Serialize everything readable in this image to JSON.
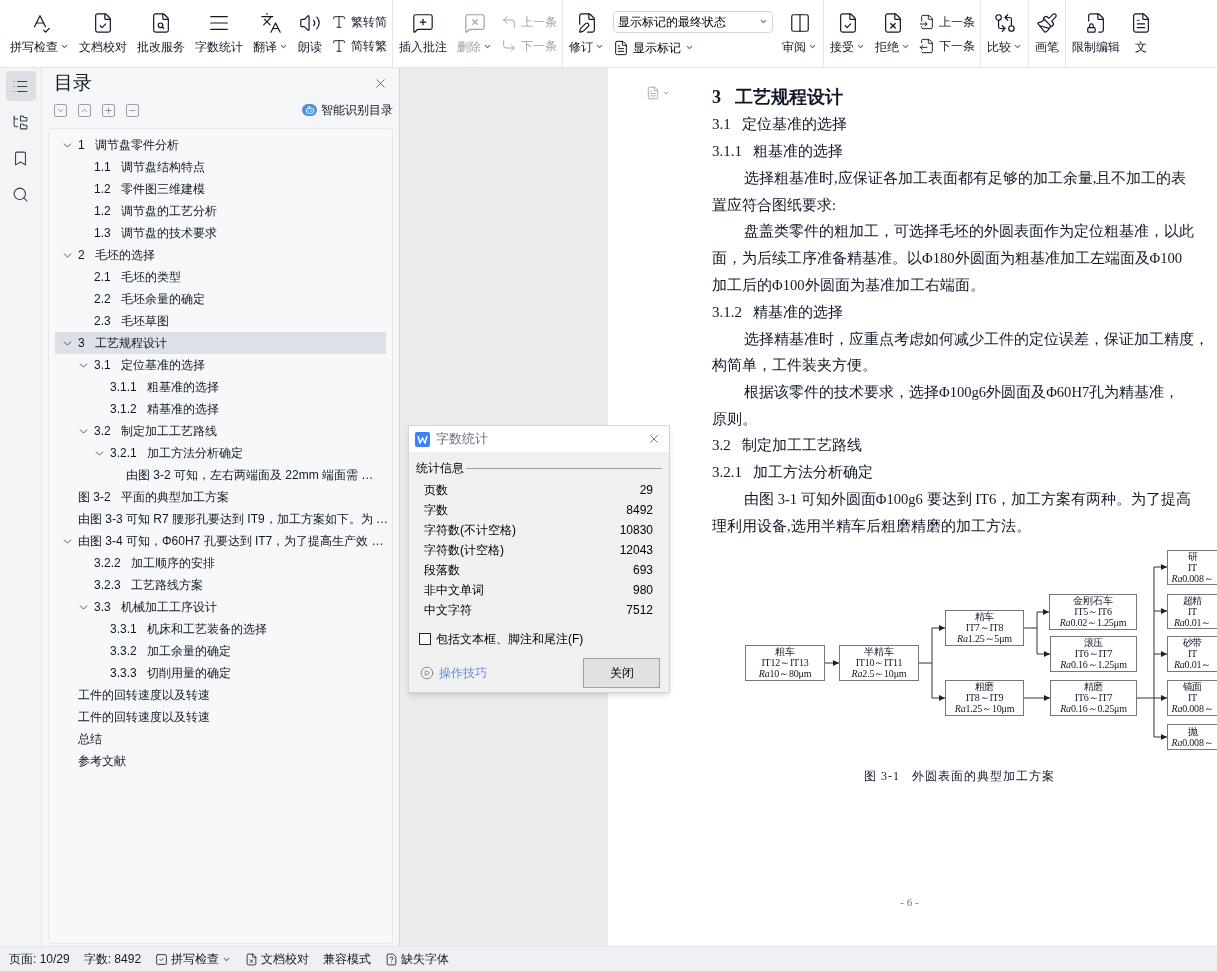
{
  "toolbar": {
    "groups": [
      {
        "items": [
          {
            "kind": "big",
            "label": "拼写检查",
            "menu": true,
            "disabled": false
          },
          {
            "kind": "big",
            "label": "文档校对",
            "menu": false,
            "disabled": false
          },
          {
            "kind": "big",
            "label": "批改服务",
            "menu": false,
            "disabled": false
          },
          {
            "kind": "big",
            "label": "字数统计",
            "menu": false,
            "disabled": false
          },
          {
            "kind": "big",
            "label": "翻译",
            "menu": true,
            "disabled": false
          },
          {
            "kind": "big",
            "label": "朗读",
            "menu": false,
            "disabled": false
          },
          {
            "kind": "pair",
            "buttons": [
              {
                "label": "繁转简",
                "disabled": false
              },
              {
                "label": "简转繁",
                "disabled": false
              }
            ]
          }
        ]
      },
      {
        "items": [
          {
            "kind": "big",
            "label": "插入批注",
            "menu": false,
            "disabled": false
          },
          {
            "kind": "big",
            "label": "删除",
            "menu": true,
            "disabled": true
          },
          {
            "kind": "pair",
            "buttons": [
              {
                "label": "上一条",
                "disabled": true
              },
              {
                "label": "下一条",
                "disabled": true
              }
            ]
          }
        ]
      },
      {
        "items": [
          {
            "kind": "big",
            "label": "修订",
            "menu": true,
            "disabled": false
          },
          {
            "kind": "combo",
            "value": "显示标记的最终状态",
            "button": {
              "label": "显示标记",
              "menu": true
            }
          },
          {
            "kind": "big",
            "label": "审阅",
            "menu": true,
            "disabled": false
          }
        ]
      },
      {
        "items": [
          {
            "kind": "big",
            "label": "接受",
            "menu": true,
            "disabled": false
          },
          {
            "kind": "big",
            "label": "拒绝",
            "menu": true,
            "disabled": false
          },
          {
            "kind": "pair",
            "buttons": [
              {
                "label": "上一条",
                "disabled": false
              },
              {
                "label": "下一条",
                "disabled": false
              }
            ]
          }
        ]
      },
      {
        "items": [
          {
            "kind": "big",
            "label": "比较",
            "menu": true,
            "disabled": false
          }
        ]
      },
      {
        "items": [
          {
            "kind": "big",
            "label": "画笔",
            "menu": false,
            "disabled": false
          }
        ]
      },
      {
        "items": [
          {
            "kind": "big",
            "label": "限制编辑",
            "menu": false,
            "disabled": false
          },
          {
            "kind": "big",
            "label": "文",
            "menu": false,
            "disabled": false
          }
        ]
      }
    ]
  },
  "rail": [
    {
      "selected": true
    },
    {
      "selected": false
    },
    {
      "selected": false
    },
    {
      "selected": false
    }
  ],
  "toc": {
    "title": "目录",
    "smart_button": "智能识别目录",
    "items": [
      {
        "text": "1   调节盘零件分析",
        "selected": false,
        "expanded": true,
        "children": [
          {
            "text": "1.1   调节盘结构特点",
            "selected": false
          },
          {
            "text": "1.2   零件图三维建模",
            "selected": false
          },
          {
            "text": "1.2   调节盘的工艺分析",
            "selected": false
          },
          {
            "text": "1.3   调节盘的技术要求",
            "selected": false
          }
        ]
      },
      {
        "text": "2   毛坯的选择",
        "selected": false,
        "expanded": true,
        "children": [
          {
            "text": "2.1   毛坯的类型",
            "selected": false
          },
          {
            "text": "2.2   毛坯余量的确定",
            "selected": false
          },
          {
            "text": "2.3   毛坯草图",
            "selected": false
          }
        ]
      },
      {
        "text": "3   工艺规程设计",
        "selected": true,
        "expanded": true,
        "children": [
          {
            "text": "3.1   定位基准的选择",
            "selected": false,
            "expanded": true,
            "children": [
              {
                "text": "3.1.1   粗基准的选择",
                "selected": false
              },
              {
                "text": "3.1.2   精基准的选择",
                "selected": false
              }
            ]
          },
          {
            "text": "3.2   制定加工工艺路线",
            "selected": false,
            "expanded": true,
            "children": [
              {
                "text": "3.2.1   加工方法分析确定",
                "selected": false,
                "expanded": true,
                "children": [
                  {
                    "text": "由图 3-2 可知，左右两端面及 22mm 端面需 …",
                    "selected": false
                  }
                ]
              }
            ]
          }
        ]
      },
      {
        "text": "图 3-2   平面的典型加工方案",
        "selected": false
      },
      {
        "text": "由图 3-3 可知 R7 腰形孔要达到 IT9，加工方案如下。为 …",
        "selected": false
      },
      {
        "text": "由图 3-4 可知，Φ60H7 孔要达到 IT7，为了提高生产效 …",
        "selected": false,
        "expanded": true,
        "children": [
          {
            "text": "3.2.2   加工顺序的安排",
            "selected": false
          },
          {
            "text": "3.2.3   工艺路线方案",
            "selected": false
          },
          {
            "text": "3.3   机械加工工序设计",
            "selected": false,
            "expanded": true,
            "children": [
              {
                "text": "3.3.1   机床和工艺装备的选择",
                "selected": false
              },
              {
                "text": "3.3.2   加工余量的确定",
                "selected": false
              },
              {
                "text": "3.3.3   切削用量的确定",
                "selected": false
              }
            ]
          }
        ]
      },
      {
        "text": "工件的回转速度以及转速",
        "selected": false
      },
      {
        "text": "工件的回转速度以及转速",
        "selected": false
      },
      {
        "text": "总结",
        "selected": false
      },
      {
        "text": "参考文献",
        "selected": false
      }
    ]
  },
  "document": {
    "blocks": [
      {
        "kind": "h1",
        "text": "3   工艺规程设计"
      },
      {
        "kind": "h2",
        "text": "3.1   定位基准的选择"
      },
      {
        "kind": "h2",
        "text": "3.1.1   粗基准的选择"
      },
      {
        "kind": "para",
        "lines": [
          "选择粗基准时,应保证各加工表面都有足够的加工余量,且不加工的表",
          "置应符合图纸要求:"
        ]
      },
      {
        "kind": "para",
        "lines": [
          "盘盖类零件的粗加工，可选择毛坯的外圆表面作为定位粗基准，以此",
          "面，为后续工序准备精基准。以Φ180外圆面为粗基准加工左端面及Φ100",
          "加工后的Φ100外圆面为基准加工右端面。"
        ]
      },
      {
        "kind": "h2",
        "text": "3.1.2   精基准的选择"
      },
      {
        "kind": "para",
        "lines": [
          "选择精基准时，应重点考虑如何减少工件的定位误差，保证加工精度，",
          "构简单，工件装夹方便。"
        ]
      },
      {
        "kind": "para",
        "lines": [
          "根据该零件的技术要求，选择Φ100g6外圆面及Φ60H7孔为精基准，",
          "原则。"
        ]
      },
      {
        "kind": "h2",
        "text": "3.2   制定加工工艺路线"
      },
      {
        "kind": "h2",
        "text": "3.2.1   加工方法分析确定"
      },
      {
        "kind": "para",
        "lines": [
          "由图 3-1 可知外圆面Φ100g6 要达到 IT6，加工方案有两种。为了提高",
          "理利用设备,选用半精车后粗磨精磨的加工方法。"
        ]
      }
    ],
    "figure": {
      "nodes": [
        {
          "lines": [
            "粗车",
            "IT12～IT13"
          ],
          "roughness": {
            "symbol": "Ra",
            "value": "10～80μm"
          }
        },
        {
          "lines": [
            "半精车",
            "IT10～IT11"
          ],
          "roughness": {
            "symbol": "Ra",
            "value": "2.5～10μm"
          }
        },
        {
          "lines": [
            "精车",
            "IT7～IT8"
          ],
          "roughness": {
            "symbol": "Ra",
            "value": "1.25～5μm"
          }
        },
        {
          "lines": [
            "粗磨",
            "IT8～IT9"
          ],
          "roughness": {
            "symbol": "Ra",
            "value": "1.25～10μm"
          }
        },
        {
          "lines": [
            "金刚石车",
            "IT5～IT6"
          ],
          "roughness": {
            "symbol": "Ra",
            "value": "0.02～1.25μm"
          }
        },
        {
          "lines": [
            "滚压",
            "IT6～IT7"
          ],
          "roughness": {
            "symbol": "Ra",
            "value": "0.16～1.25μm"
          }
        },
        {
          "lines": [
            "精磨",
            "IT6～IT7"
          ],
          "roughness": {
            "symbol": "Ra",
            "value": "0.16～0.25μm"
          }
        },
        {
          "lines": [
            "研",
            "IT"
          ],
          "roughness": {
            "symbol": "Ra",
            "value": "0.008～"
          }
        },
        {
          "lines": [
            "超精",
            "IT"
          ],
          "roughness": {
            "symbol": "Ra",
            "value": "0.01～"
          }
        },
        {
          "lines": [
            "砂带",
            "IT"
          ],
          "roughness": {
            "symbol": "Ra",
            "value": "0.01～"
          }
        },
        {
          "lines": [
            "镜面",
            "IT"
          ],
          "roughness": {
            "symbol": "Ra",
            "value": "0.008～"
          }
        },
        {
          "lines": [
            "抛"
          ],
          "roughness": {
            "symbol": "Ra",
            "value": "0.008～"
          }
        }
      ],
      "caption": "图 3-1   外圆表面的典型加工方案"
    },
    "page_number": "- 6 -"
  },
  "dialog": {
    "title": "字数统计",
    "group": "统计信息",
    "rows": [
      {
        "label": "页数",
        "value": "29"
      },
      {
        "label": "字数",
        "value": "8492"
      },
      {
        "label": "字符数(不计空格)",
        "value": "10830"
      },
      {
        "label": "字符数(计空格)",
        "value": "12043"
      },
      {
        "label": "段落数",
        "value": "693"
      },
      {
        "label": "非中文单词",
        "value": "980"
      },
      {
        "label": "中文字符",
        "value": "7512"
      }
    ],
    "checkbox": {
      "label": "包括文本框、脚注和尾注(F)",
      "checked": false
    },
    "tips_link": "操作技巧",
    "close_button": "关闭"
  },
  "status_bar": [
    {
      "kind": "text",
      "text": "页面: 10/29"
    },
    {
      "kind": "text",
      "text": "字数: 8492"
    },
    {
      "kind": "button",
      "text": "拼写检查",
      "menu": true
    },
    {
      "kind": "button",
      "text": "文档校对",
      "menu": false
    },
    {
      "kind": "text",
      "text": "兼容模式"
    },
    {
      "kind": "button",
      "text": "缺失字体",
      "menu": false
    }
  ]
}
